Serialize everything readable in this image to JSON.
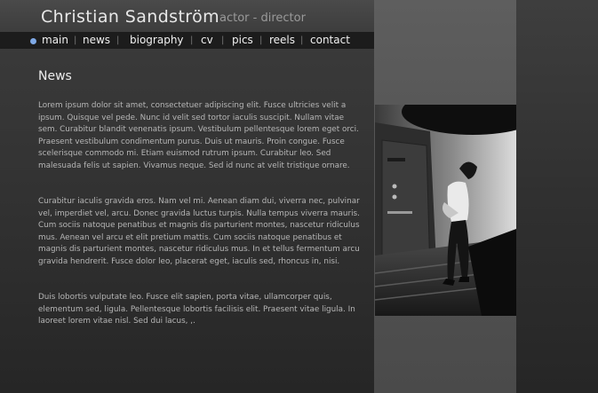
{
  "header": {
    "name": "Christian Sandström",
    "tagline": "actor - director"
  },
  "nav": {
    "items": [
      {
        "label": "main",
        "active": true
      },
      {
        "label": "news"
      },
      {
        "label": "biography"
      },
      {
        "label": "cv"
      },
      {
        "label": "pics"
      },
      {
        "label": "reels"
      },
      {
        "label": "contact"
      }
    ],
    "separator": "|",
    "active_bullet_color": "#7fa9e6"
  },
  "main": {
    "title": "News",
    "paragraphs": [
      "Lorem ipsum dolor sit amet, consectetuer adipiscing elit. Fusce ultricies velit a ipsum. Quisque vel pede. Nunc id velit sed tortor iaculis suscipit. Nullam vitae sem. Curabitur blandit venenatis ipsum. Vestibulum pellentesque lorem eget orci. Praesent vestibulum condimentum purus. Duis ut mauris. Proin congue. Fusce scelerisque commodo mi. Etiam euismod rutrum ipsum. Curabitur leo. Sed malesuada felis ut sapien. Vivamus neque. Sed id nunc at velit tristique ornare.",
      "Curabitur iaculis gravida eros. Nam vel mi. Aenean diam dui, viverra nec, pulvinar vel, imperdiet vel, arcu. Donec gravida luctus turpis. Nulla tempus viverra mauris. Cum sociis natoque penatibus et magnis dis parturient montes, nascetur ridiculus mus. Aenean vel arcu et elit pretium mattis. Cum sociis natoque penatibus et magnis dis parturient montes, nascetur ridiculus mus. In et tellus fermentum arcu gravida hendrerit. Fusce dolor leo, placerat eget, iaculis sed, rhoncus in, nisi.",
      "Duis lobortis vulputate leo. Fusce elit sapien, porta vitae, ullamcorper quis, elementum sed, ligula. Pellentesque lobortis facilisis elit. Praesent vitae ligula. In laoreet lorem vitae nisl. Sed dui lacus, ,."
    ]
  }
}
